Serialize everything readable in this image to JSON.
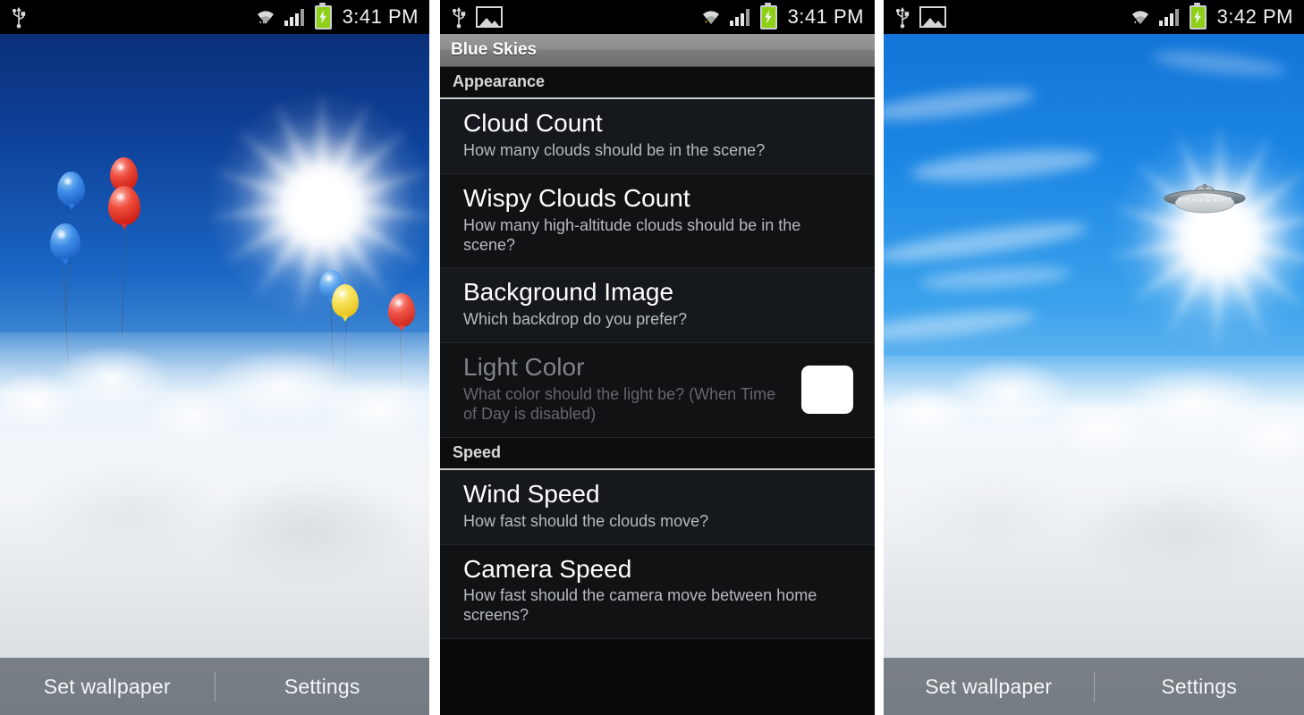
{
  "panels": {
    "left": {
      "name": "wallpaper-preview-balloons",
      "statusbar": {
        "time": "3:41 PM",
        "icons": [
          "usb-icon",
          "wifi-icon",
          "signal-icon",
          "battery-charging-icon"
        ]
      },
      "actionbar": {
        "set_wallpaper": "Set wallpaper",
        "settings": "Settings"
      }
    },
    "middle": {
      "name": "live-wallpaper-settings",
      "statusbar": {
        "time": "3:41 PM",
        "icons": [
          "usb-icon",
          "screenshot-image-icon",
          "wifi-icon",
          "signal-icon",
          "battery-charging-icon"
        ]
      },
      "title": "Blue Skies",
      "sections": [
        {
          "header": "Appearance",
          "rows": [
            {
              "title": "Cloud Count",
              "summary": "How many clouds should be in the scene?",
              "disabled": false,
              "widget": null
            },
            {
              "title": "Wispy Clouds Count",
              "summary": "How many high-altitude clouds should be in the scene?",
              "disabled": false,
              "widget": null
            },
            {
              "title": "Background Image",
              "summary": "Which backdrop do you prefer?",
              "disabled": false,
              "widget": null
            },
            {
              "title": "Light Color",
              "summary": "What color should the light be? (When Time of Day is disabled)",
              "disabled": true,
              "widget": "color-swatch",
              "widget_color": "#ffffff"
            }
          ]
        },
        {
          "header": "Speed",
          "rows": [
            {
              "title": "Wind Speed",
              "summary": "How fast should the clouds move?",
              "disabled": false,
              "widget": null
            },
            {
              "title": "Camera Speed",
              "summary": "How fast should the camera move between home screens?",
              "disabled": false,
              "widget": null
            }
          ]
        }
      ]
    },
    "right": {
      "name": "wallpaper-preview-ufo",
      "statusbar": {
        "time": "3:42 PM",
        "icons": [
          "usb-icon",
          "screenshot-image-icon",
          "wifi-icon",
          "signal-icon",
          "battery-charging-icon"
        ]
      },
      "actionbar": {
        "set_wallpaper": "Set wallpaper",
        "settings": "Settings"
      }
    }
  },
  "colors": {
    "battery_charging": "#8ed016",
    "titlebar_top": "#9a9a9a",
    "titlebar_bottom": "#6f6f6f",
    "row_background": "#15181c",
    "section_background": "#0d0d0d",
    "light_color_swatch": "#ffffff",
    "sky_left_top": "#0a2a6e",
    "sky_right_top": "#0f6fd4"
  },
  "scene_left": {
    "balloons": [
      {
        "color": "#2b7ae0",
        "name": "blue-balloon"
      },
      {
        "color": "#2b7ae0",
        "name": "blue-balloon"
      },
      {
        "color": "#e03030",
        "name": "red-balloon"
      },
      {
        "color": "#e03030",
        "name": "red-balloon"
      },
      {
        "color": "#3b8fe8",
        "name": "blue-balloon"
      },
      {
        "color": "#f2d93b",
        "name": "yellow-balloon"
      },
      {
        "color": "#e8453c",
        "name": "red-balloon"
      }
    ]
  },
  "scene_right": {
    "object": "ufo"
  }
}
